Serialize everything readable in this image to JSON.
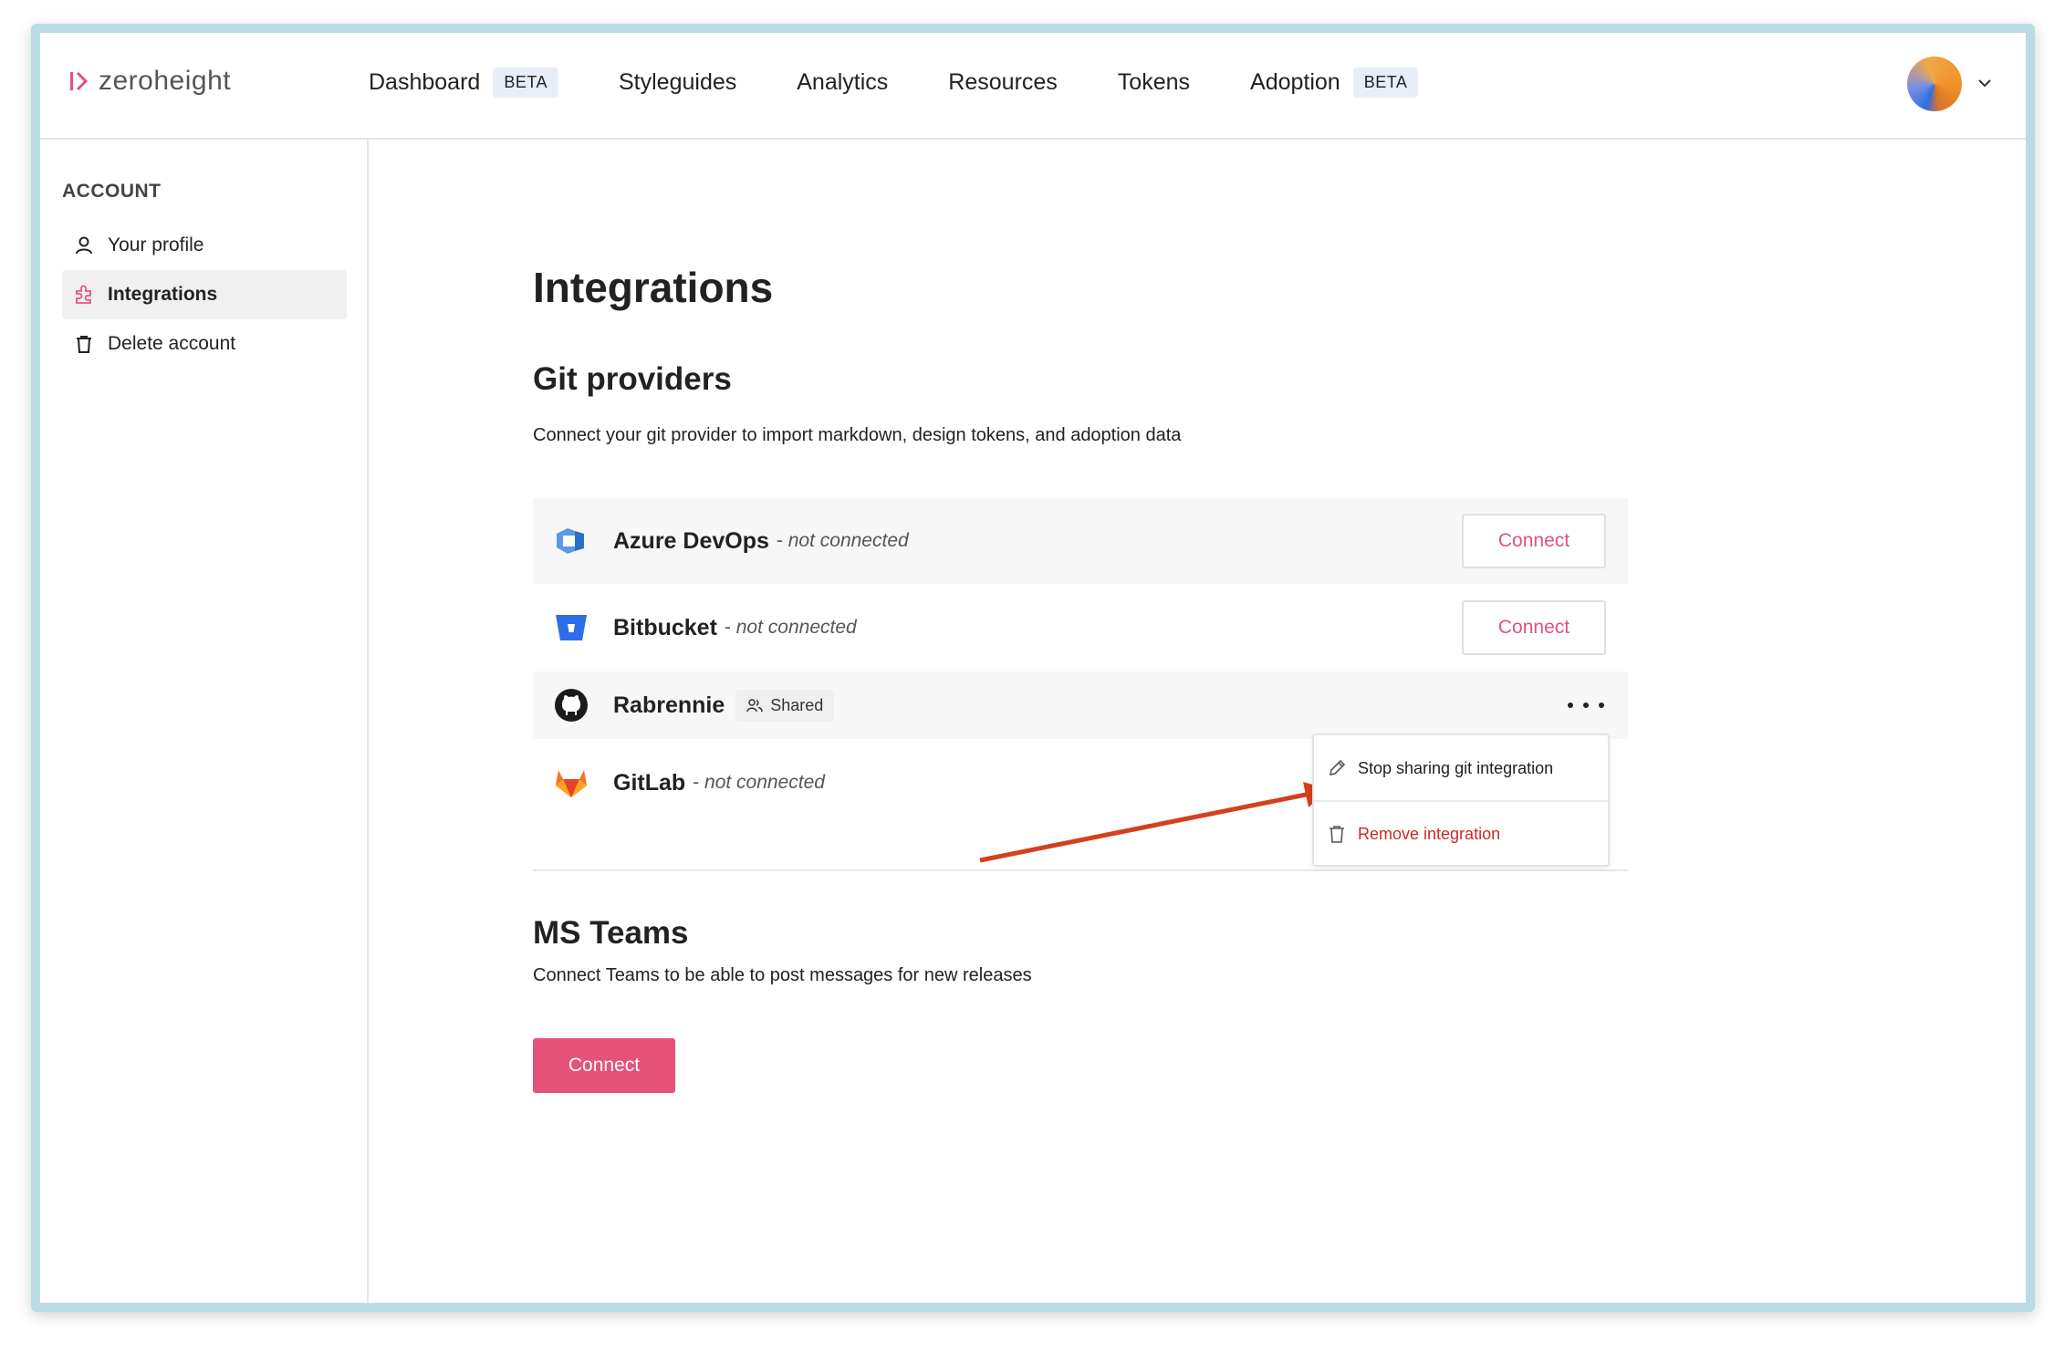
{
  "brand": {
    "name": "zeroheight",
    "accent": "#e6517a",
    "annotation_arrow_color": "#d4401c"
  },
  "nav": {
    "items": [
      {
        "label": "Dashboard",
        "badge": "BETA"
      },
      {
        "label": "Styleguides",
        "badge": null
      },
      {
        "label": "Analytics",
        "badge": null
      },
      {
        "label": "Resources",
        "badge": null
      },
      {
        "label": "Tokens",
        "badge": null
      },
      {
        "label": "Adoption",
        "badge": "BETA"
      }
    ]
  },
  "sidebar": {
    "heading": "ACCOUNT",
    "items": [
      {
        "label": "Your profile",
        "icon": "user-icon"
      },
      {
        "label": "Integrations",
        "icon": "puzzle-icon",
        "active": true
      },
      {
        "label": "Delete account",
        "icon": "trash-icon"
      }
    ]
  },
  "main": {
    "title": "Integrations",
    "git": {
      "title": "Git providers",
      "description": "Connect your git provider to import markdown, design tokens, and adoption data",
      "providers": [
        {
          "name": "Azure DevOps",
          "status": "not connected",
          "action": "Connect",
          "icon": "azure-devops-icon"
        },
        {
          "name": "Bitbucket",
          "status": "not connected",
          "action": "Connect",
          "icon": "bitbucket-icon"
        },
        {
          "name": "Rabrennie",
          "badge": "Shared",
          "icon": "github-icon"
        },
        {
          "name": "GitLab",
          "status": "not connected",
          "icon": "gitlab-icon"
        }
      ],
      "status_separator": "-"
    },
    "menu": {
      "stop_sharing": "Stop sharing git integration",
      "remove": "Remove integration"
    },
    "teams": {
      "title": "MS Teams",
      "description": "Connect Teams to be able to post messages for new releases",
      "action": "Connect"
    }
  }
}
